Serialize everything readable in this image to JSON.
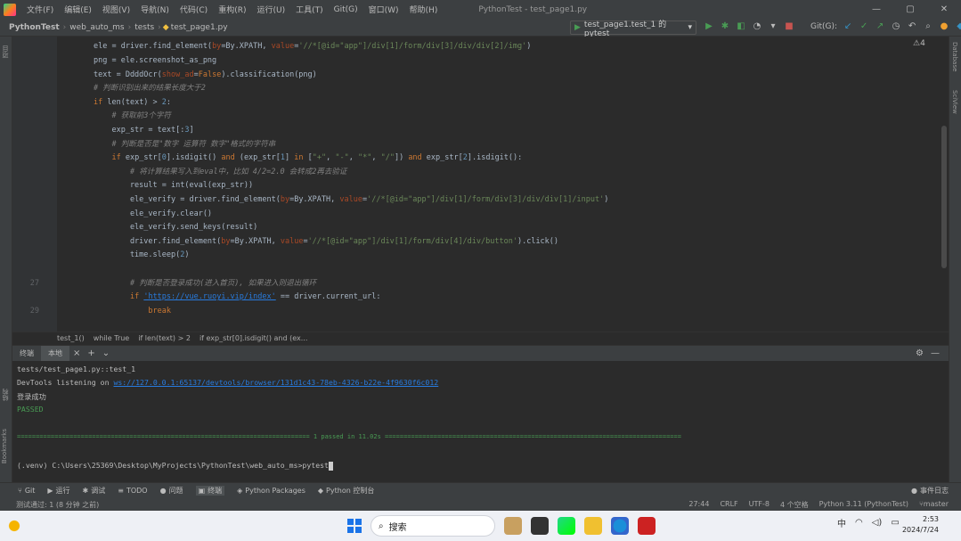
{
  "menubar": {
    "items": [
      "文件(F)",
      "编辑(E)",
      "视图(V)",
      "导航(N)",
      "代码(C)",
      "重构(R)",
      "运行(U)",
      "工具(T)",
      "Git(G)",
      "窗口(W)",
      "帮助(H)"
    ],
    "title": "PythonTest - test_page1.py",
    "minimize": "—",
    "maximize": "▢",
    "close": "✕"
  },
  "breadcrumb": {
    "items": [
      "PythonTest",
      "web_auto_ms",
      "tests",
      "test_page1.py"
    ]
  },
  "toolbar": {
    "run_config": "test_page1.test_1 的 pytest",
    "git_label": "Git(G):"
  },
  "left_stripe": {
    "project": "项目",
    "bookmarks": "Bookmarks",
    "structure": "结构"
  },
  "right_stripe": {
    "database": "Database",
    "sciview": "SciView"
  },
  "editor": {
    "warnings": "⚠4",
    "lines": [
      {
        "n": "",
        "html": "ele = driver.find_element(<span class=\"param\">by</span>=By.XPATH, <span class=\"param\">value</span>=<span class=\"str\">'//*[@id=\"app\"]/div[1]/form/div[3]/div/div[2]/img'</span>)"
      },
      {
        "n": "",
        "html": "png = ele.screenshot_as_png"
      },
      {
        "n": "",
        "html": "text = DdddOcr(<span class=\"param\">show_ad</span>=<span class=\"kw\">False</span>).classification(png)"
      },
      {
        "n": "",
        "html": "<span class=\"cmt\"># 判断识别出来的结果长度大于2</span>"
      },
      {
        "n": "",
        "html": "<span class=\"kw\">if</span> len(text) > <span class=\"num\">2</span>:"
      },
      {
        "n": "",
        "html": "    <span class=\"cmt\"># 获取前3个字符</span>"
      },
      {
        "n": "",
        "html": "    exp_str = text[:<span class=\"num\">3</span>]"
      },
      {
        "n": "",
        "html": "    <span class=\"cmt\"># 判断是否是\"数字 运算符 数字\"格式的字符串</span>"
      },
      {
        "n": "",
        "html": "    <span class=\"kw\">if</span> exp_str[<span class=\"num\">0</span>].isdigit() <span class=\"kw\">and</span> (exp_str[<span class=\"num\">1</span>] <span class=\"kw\">in</span> [<span class=\"str\">\"+\"</span>, <span class=\"str\">\"-\"</span>, <span class=\"str\">\"*\"</span>, <span class=\"str\">\"/\"</span>]) <span class=\"kw\">and</span> exp_str[<span class=\"num\">2</span>].isdigit():"
      },
      {
        "n": "",
        "html": "        <span class=\"cmt\"># 将计算结果写入到eval中，比如 4/2=2.0 会转成2再去验证</span>"
      },
      {
        "n": "",
        "html": "        result = int(eval(exp_str))"
      },
      {
        "n": "",
        "html": "        ele_verify = driver.find_element(<span class=\"param\">by</span>=By.XPATH, <span class=\"param\">value</span>=<span class=\"str\">'//*[@id=\"app\"]/div[1]/form/div[3]/div/div[1]/input'</span>)"
      },
      {
        "n": "",
        "html": "        ele_verify.clear()"
      },
      {
        "n": "",
        "html": "        ele_verify.send_keys(result)"
      },
      {
        "n": "",
        "html": "        driver.find_element(<span class=\"param\">by</span>=By.XPATH, <span class=\"param\">value</span>=<span class=\"str\">'//*[@id=\"app\"]/div[1]/form/div[4]/div/button'</span>).click()"
      },
      {
        "n": "",
        "html": "        time.sleep(<span class=\"num\">2</span>)"
      },
      {
        "n": "",
        "html": ""
      },
      {
        "n": "27",
        "html": "        <span class=\"cmt\"># 判断是否登录成功(进入首页), 如果进入则退出循环</span>"
      },
      {
        "n": "",
        "html": "        <span class=\"kw\">if</span> <span class=\"link\">'https://vue.ruoyi.vip/index'</span> == driver.current_url:"
      },
      {
        "n": "29",
        "html": "            <span class=\"kw\">break</span>"
      }
    ]
  },
  "crumbbar": {
    "items": [
      "test_1()",
      "while True",
      "if len(text) > 2",
      "if exp_str[0].isdigit() and (ex..."
    ]
  },
  "run_panel": {
    "tabs": [
      "终端",
      "本地"
    ],
    "lines": [
      "tests/test_page1.py::test_1",
      "DevTools listening on ws://127.0.0.1:65137/devtools/browser/131d1c43-78eb-4326-b22e-4f9630f6c012",
      "登录成功",
      "PASSED",
      "============================================================================== 1 passed in 11.02s ===============================================================================",
      "(.venv) C:\\Users\\25369\\Desktop\\MyProjects\\PythonTest\\web_auto_ms>pytest"
    ]
  },
  "bottom_tools": {
    "items": [
      "Git",
      "运行",
      "调试",
      "TODO",
      "问题",
      "终端",
      "Python Packages",
      "Python 控制台"
    ],
    "event_log": "事件日志"
  },
  "statusbar": {
    "message": "测试通过: 1 (8 分钟 之前)",
    "position": "27:44",
    "line_sep": "CRLF",
    "encoding": "UTF-8",
    "indent": "4 个空格",
    "interpreter": "Python 3.11 (PythonTest)",
    "branch": "master"
  },
  "taskbar": {
    "search_placeholder": "搜索",
    "time": "2:53",
    "date": "2024/7/24",
    "lang": "中"
  }
}
